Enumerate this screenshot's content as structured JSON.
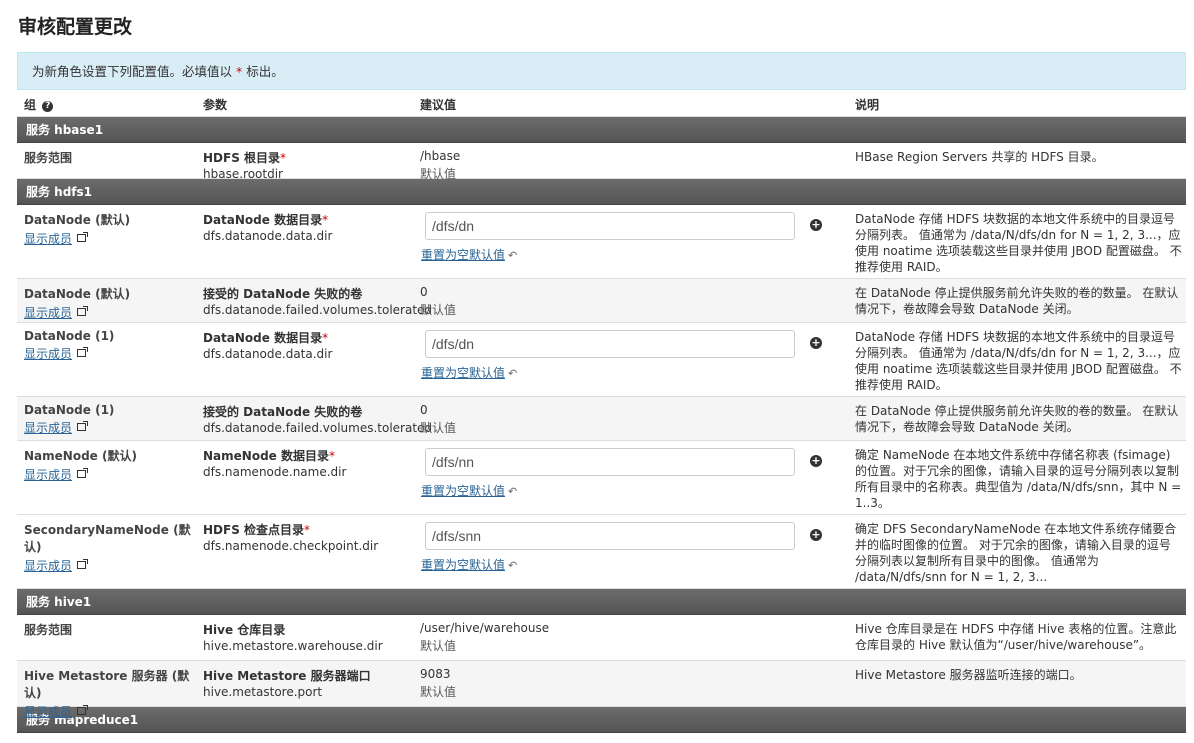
{
  "title": "审核配置更改",
  "info": {
    "text": "为新角色设置下列配置值。必填值以",
    "marker": "*",
    "suffix": "标出。"
  },
  "columns": {
    "group": "组",
    "param": "参数",
    "value": "建议值",
    "desc": "说明"
  },
  "common": {
    "show_members": "显示成员",
    "default": "默认值",
    "reset": "重置为空默认值"
  },
  "services": [
    {
      "name": "服务 hbase1",
      "rows": [
        {
          "group": "服务范围",
          "label": "HDFS 根目录",
          "required": true,
          "key": "hbase.rootdir",
          "value": "/hbase",
          "editable": false,
          "desc": "HBase Region Servers 共享的 HDFS 目录。"
        }
      ]
    },
    {
      "name": "服务 hdfs1",
      "rows": [
        {
          "group": "DataNode (默认)",
          "label": "DataNode 数据目录",
          "required": true,
          "key": "dfs.datanode.data.dir",
          "value": "/dfs/dn",
          "editable": true,
          "desc": "DataNode 存储 HDFS 块数据的本地文件系统中的目录逗号分隔列表。 值通常为 /data/N/dfs/dn for N = 1, 2, 3...，应使用 noatime 选项装载这些目录并使用 JBOD 配置磁盘。 不推荐使用 RAID。"
        },
        {
          "group": "DataNode (默认)",
          "label": "接受的 DataNode 失败的卷",
          "required": false,
          "key": "dfs.datanode.failed.volumes.tolerated",
          "value": "0",
          "editable": false,
          "desc": "在 DataNode 停止提供服务前允许失败的卷的数量。 在默认情况下，卷故障会导致 DataNode 关闭。"
        },
        {
          "group": "DataNode (1)",
          "label": "DataNode 数据目录",
          "required": true,
          "key": "dfs.datanode.data.dir",
          "value": "/dfs/dn",
          "editable": true,
          "desc": "DataNode 存储 HDFS 块数据的本地文件系统中的目录逗号分隔列表。 值通常为 /data/N/dfs/dn for N = 1, 2, 3...，应使用 noatime 选项装载这些目录并使用 JBOD 配置磁盘。 不推荐使用 RAID。"
        },
        {
          "group": "DataNode (1)",
          "label": "接受的 DataNode 失败的卷",
          "required": false,
          "key": "dfs.datanode.failed.volumes.tolerated",
          "value": "0",
          "editable": false,
          "desc": "在 DataNode 停止提供服务前允许失败的卷的数量。 在默认情况下，卷故障会导致 DataNode 关闭。"
        },
        {
          "group": "NameNode (默认)",
          "label": "NameNode 数据目录",
          "required": true,
          "key": "dfs.namenode.name.dir",
          "value": "/dfs/nn",
          "editable": true,
          "desc": "确定 NameNode 在本地文件系统中存储名称表 (fsimage) 的位置。对于冗余的图像，请输入目录的逗号分隔列表以复制所有目录中的名称表。典型值为 /data/N/dfs/snn，其中 N = 1..3。"
        },
        {
          "group": "SecondaryNameNode (默认)",
          "label": "HDFS 检查点目录",
          "required": true,
          "key": "dfs.namenode.checkpoint.dir",
          "value": "/dfs/snn",
          "editable": true,
          "desc": "确定 DFS SecondaryNameNode 在本地文件系统存储要合并的临时图像的位置。 对于冗余的图像，请输入目录的逗号分隔列表以复制所有目录中的图像。 值通常为 /data/N/dfs/snn for N = 1, 2, 3..."
        }
      ]
    },
    {
      "name": "服务 hive1",
      "rows": [
        {
          "group": "服务范围",
          "label": "Hive 仓库目录",
          "required": false,
          "key": "hive.metastore.warehouse.dir",
          "value": "/user/hive/warehouse",
          "editable": false,
          "desc": "Hive 仓库目录是在 HDFS 中存储 Hive 表格的位置。注意此仓库目录的 Hive 默认值为“/user/hive/warehouse”。"
        },
        {
          "group": "Hive Metastore 服务器 (默认)",
          "label": "Hive Metastore 服务器端口",
          "required": false,
          "key": "hive.metastore.port",
          "value": "9083",
          "editable": false,
          "desc": "Hive Metastore 服务器监听连接的端口。"
        }
      ]
    },
    {
      "name": "服务 mapreduce1",
      "rows": []
    }
  ]
}
